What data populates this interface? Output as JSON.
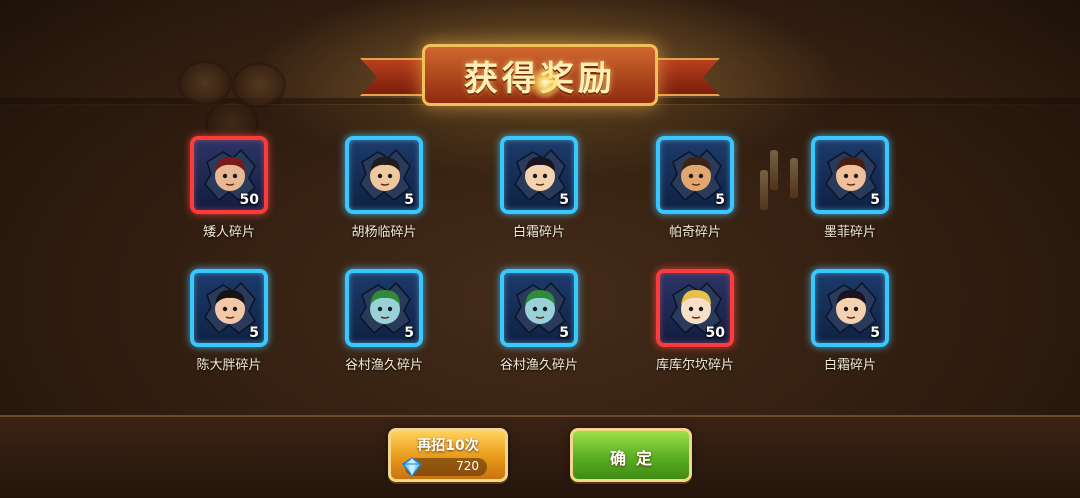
{
  "title": "获得奖励",
  "rewards": [
    {
      "name": "矮人碎片",
      "count": "50",
      "rarity": "red",
      "skin": "#e8b894",
      "hair": "#7a1a1a"
    },
    {
      "name": "胡杨临碎片",
      "count": "5",
      "rarity": "blue",
      "skin": "#f0c8a0",
      "hair": "#1e1e1e"
    },
    {
      "name": "白霜碎片",
      "count": "5",
      "rarity": "blue",
      "skin": "#f4d2b0",
      "hair": "#1a1420"
    },
    {
      "name": "帕奇碎片",
      "count": "5",
      "rarity": "blue",
      "skin": "#e0a870",
      "hair": "#3a2414"
    },
    {
      "name": "墨菲碎片",
      "count": "5",
      "rarity": "blue",
      "skin": "#f0c09a",
      "hair": "#4a1e12"
    },
    {
      "name": "陈大胖碎片",
      "count": "5",
      "rarity": "blue",
      "skin": "#f2c8a8",
      "hair": "#141414"
    },
    {
      "name": "谷村渔久碎片",
      "count": "5",
      "rarity": "blue",
      "skin": "#9ad0d8",
      "hair": "#2f8a3a"
    },
    {
      "name": "谷村渔久碎片",
      "count": "5",
      "rarity": "blue",
      "skin": "#9ad0d8",
      "hair": "#2f8a3a"
    },
    {
      "name": "库库尔坎碎片",
      "count": "50",
      "rarity": "red",
      "skin": "#f6e0c8",
      "hair": "#e8c04a"
    },
    {
      "name": "白霜碎片",
      "count": "5",
      "rarity": "blue",
      "skin": "#f4d2b0",
      "hair": "#1a1420"
    }
  ],
  "buttons": {
    "recruit_label": "再招10次",
    "recruit_cost": "720",
    "confirm_label": "确定"
  },
  "colors": {
    "blue_frame": "#37c8ff",
    "red_frame": "#ff3a3a",
    "recruit_button": "#e89a1a",
    "confirm_button": "#5aae22"
  },
  "icons": {
    "cost": "diamond-gem-icon",
    "reward": "hero-fragment-icon"
  }
}
